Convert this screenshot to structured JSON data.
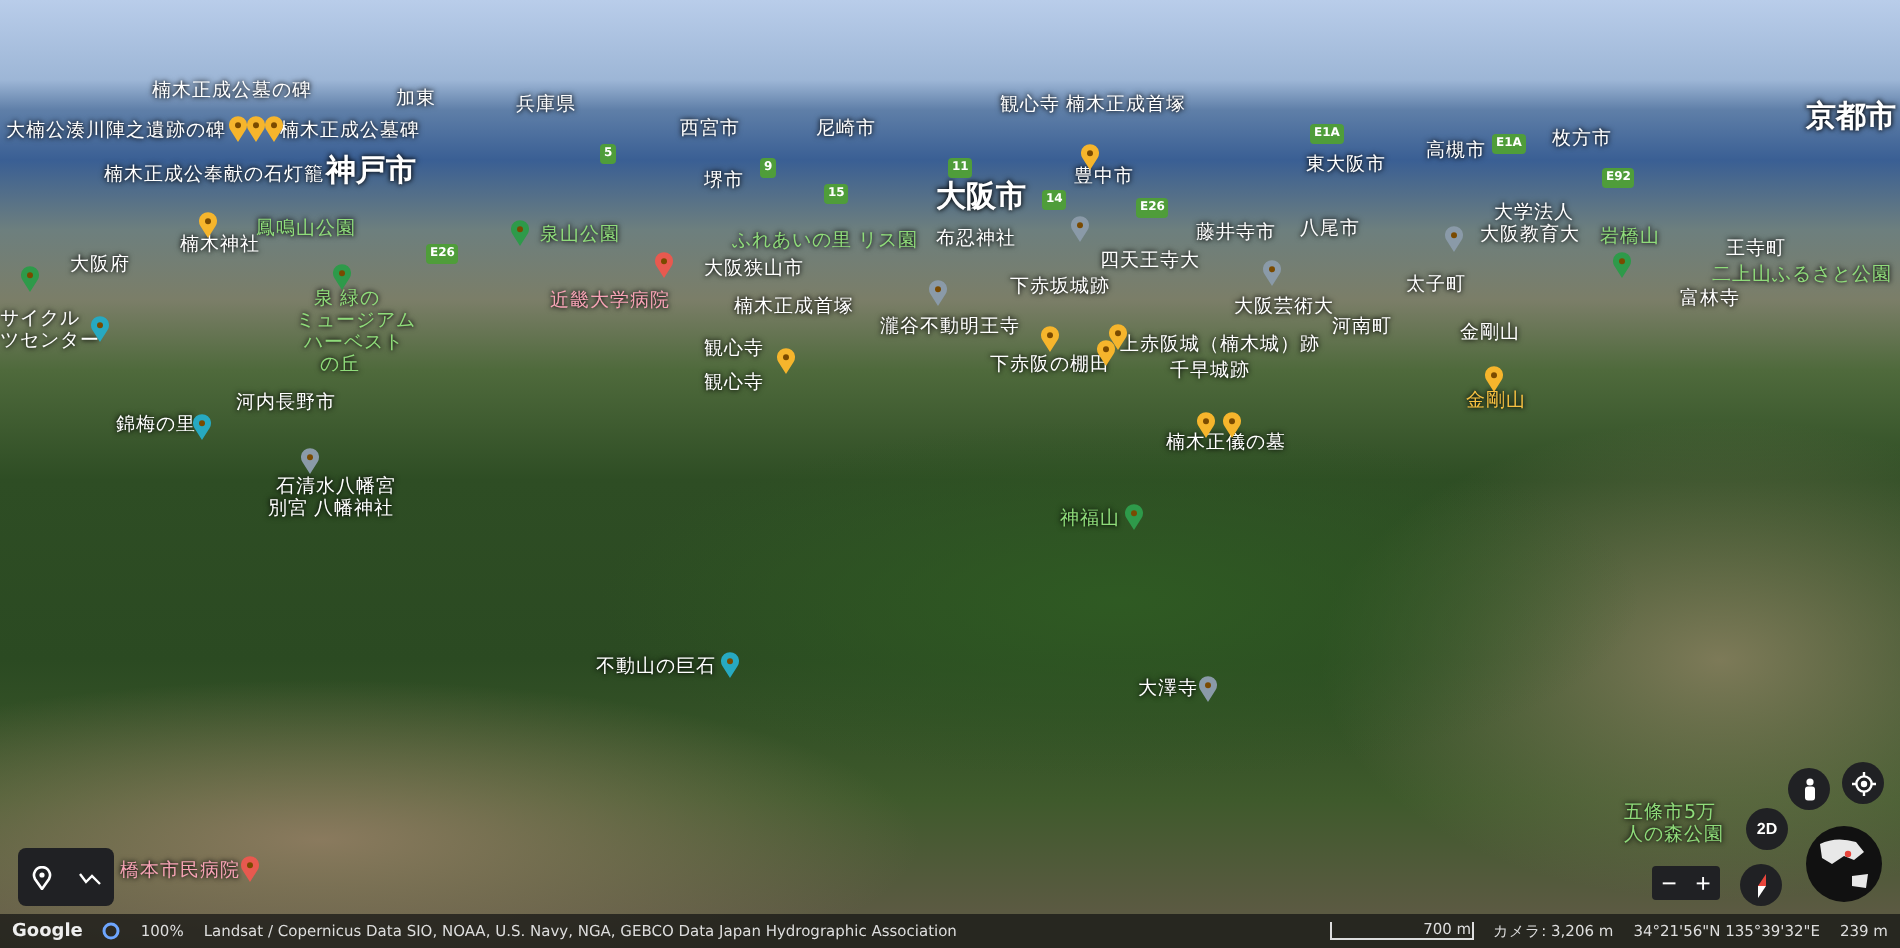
{
  "map": {
    "labels": [
      {
        "text": "楠木正成公墓の碑",
        "kind": "place"
      },
      {
        "text": "大楠公湊川陣之遺跡の碑",
        "kind": "place"
      },
      {
        "text": "楠木正成公墓碑",
        "kind": "place"
      },
      {
        "text": "楠木正成公奉献の石灯籠",
        "kind": "place"
      },
      {
        "text": "神戸市",
        "kind": "city"
      },
      {
        "text": "加東",
        "kind": "place"
      },
      {
        "text": "兵庫県",
        "kind": "place"
      },
      {
        "text": "楠木神社",
        "kind": "place"
      },
      {
        "text": "大阪府",
        "kind": "place"
      },
      {
        "text": "鳳鳴山公園",
        "kind": "park"
      },
      {
        "text": "泉山公園",
        "kind": "park"
      },
      {
        "text": "サイクル",
        "kind": "place"
      },
      {
        "text": "ツセンター",
        "kind": "place"
      },
      {
        "text": "泉 緑の",
        "kind": "park"
      },
      {
        "text": "ミュージアム",
        "kind": "park"
      },
      {
        "text": "ハーベスト",
        "kind": "park"
      },
      {
        "text": "の丘",
        "kind": "park"
      },
      {
        "text": "近畿大学病院",
        "kind": "hospital"
      },
      {
        "text": "西宮市",
        "kind": "place"
      },
      {
        "text": "尼崎市",
        "kind": "place"
      },
      {
        "text": "観心寺 楠木正成首塚",
        "kind": "place"
      },
      {
        "text": "堺市",
        "kind": "place"
      },
      {
        "text": "大阪市",
        "kind": "city"
      },
      {
        "text": "豊中市",
        "kind": "place"
      },
      {
        "text": "ふれあいの里 リス園",
        "kind": "park"
      },
      {
        "text": "布忍神社",
        "kind": "place"
      },
      {
        "text": "大阪狭山市",
        "kind": "place"
      },
      {
        "text": "四天王寺大",
        "kind": "place"
      },
      {
        "text": "藤井寺市",
        "kind": "place"
      },
      {
        "text": "下赤坂城跡",
        "kind": "place"
      },
      {
        "text": "楠木正成首塚",
        "kind": "place"
      },
      {
        "text": "瀧谷不動明王寺",
        "kind": "place"
      },
      {
        "text": "観心寺",
        "kind": "place"
      },
      {
        "text": "観心寺",
        "kind": "place"
      },
      {
        "text": "下赤阪の棚田",
        "kind": "place"
      },
      {
        "text": "上赤阪城（楠木城）跡",
        "kind": "place"
      },
      {
        "text": "千早城跡",
        "kind": "place"
      },
      {
        "text": "東大阪市",
        "kind": "place"
      },
      {
        "text": "八尾市",
        "kind": "place"
      },
      {
        "text": "高槻市",
        "kind": "place"
      },
      {
        "text": "枚方市",
        "kind": "place"
      },
      {
        "text": "大学法人",
        "kind": "place"
      },
      {
        "text": "大阪教育大",
        "kind": "place"
      },
      {
        "text": "岩橋山",
        "kind": "park"
      },
      {
        "text": "王寺町",
        "kind": "place"
      },
      {
        "text": "二上山ふるさと公園",
        "kind": "park"
      },
      {
        "text": "大阪芸術大",
        "kind": "place"
      },
      {
        "text": "太子町",
        "kind": "place"
      },
      {
        "text": "富林寺",
        "kind": "place"
      },
      {
        "text": "河南町",
        "kind": "place"
      },
      {
        "text": "金剛山",
        "kind": "place"
      },
      {
        "text": "金剛山",
        "kind": "pin"
      },
      {
        "text": "京都市",
        "kind": "city"
      },
      {
        "text": "河内長野市",
        "kind": "place"
      },
      {
        "text": "錦梅の里",
        "kind": "place"
      },
      {
        "text": "石清水八幡宮",
        "kind": "place"
      },
      {
        "text": "別宮 八幡神社",
        "kind": "place"
      },
      {
        "text": "楠木正儀の墓",
        "kind": "place"
      },
      {
        "text": "神福山",
        "kind": "park"
      },
      {
        "text": "不動山の巨石",
        "kind": "place"
      },
      {
        "text": "大澤寺",
        "kind": "place"
      },
      {
        "text": "五條市5万",
        "kind": "park"
      },
      {
        "text": "人の森公園",
        "kind": "park"
      },
      {
        "text": "橋本市民病院",
        "kind": "hospital"
      }
    ],
    "shields": [
      "5",
      "9",
      "15",
      "11",
      "14",
      "E26",
      "E26",
      "E1A",
      "E1A",
      "E92"
    ]
  },
  "status_bar": {
    "logo": "Google",
    "zoom": "100%",
    "attribution": "Landsat / Copernicus  Data SIO, NOAA, U.S. Navy, NGA, GEBCO  Data Japan Hydrographic Association",
    "scale": "700 m",
    "camera": "カメラ: 3,206 m",
    "coordinates": "34°21'56\"N 135°39'32\"E",
    "elevation": "239 m"
  },
  "controls": {
    "view_toggle": "2D",
    "zoom_out": "−",
    "zoom_in": "+"
  }
}
